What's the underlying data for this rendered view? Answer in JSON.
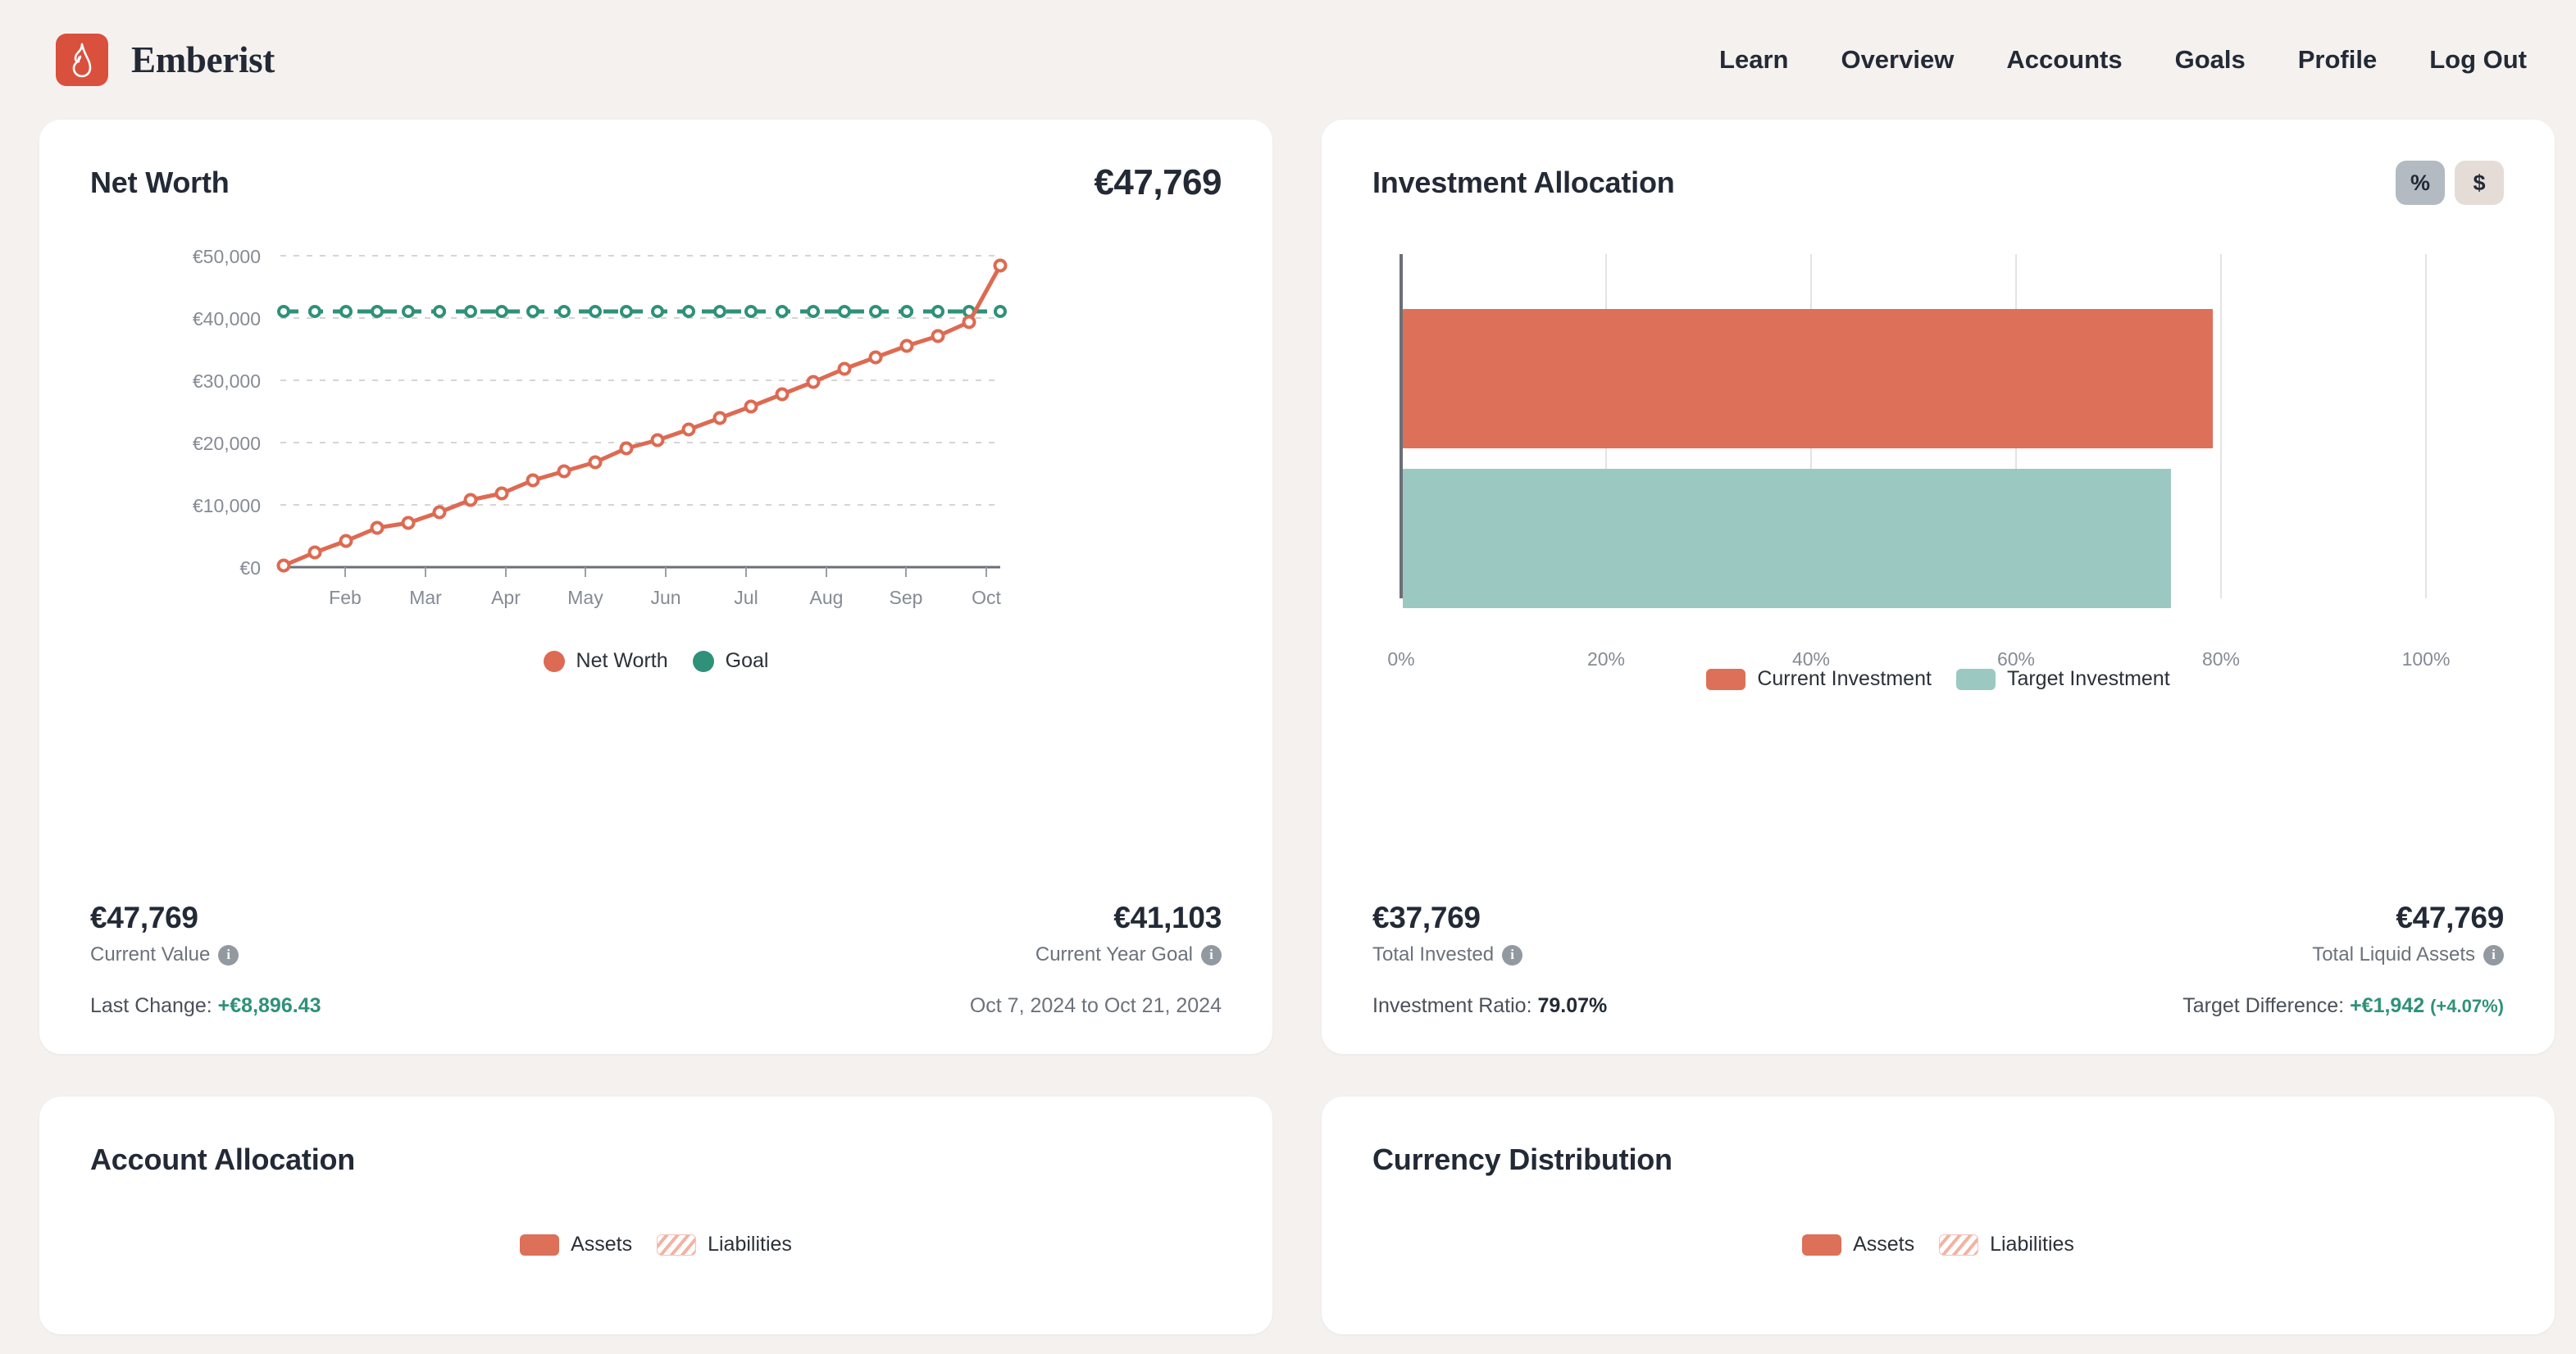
{
  "header": {
    "brand": "Emberist",
    "logo_icon": "flame-icon",
    "logo_color": "#d9503c",
    "nav": [
      {
        "label": "Learn"
      },
      {
        "label": "Overview"
      },
      {
        "label": "Accounts"
      },
      {
        "label": "Goals"
      },
      {
        "label": "Profile"
      },
      {
        "label": "Log Out"
      }
    ]
  },
  "colors": {
    "page_background": "#f5f1ef",
    "card_background": "#ffffff",
    "accent_red": "#dd7059",
    "accent_teal": "#9cc8c2",
    "goal_teal": "#2f9179",
    "text_dark": "#232a36",
    "text_muted": "#6c727b",
    "positive_green": "#2f9179"
  },
  "net_worth_card": {
    "title": "Net Worth",
    "amount": "€47,769",
    "stats": {
      "left_value": "€47,769",
      "left_label": "Current Value",
      "left_info_icon": "info-icon",
      "right_value": "€41,103",
      "right_label": "Current Year Goal",
      "right_info_icon": "info-icon"
    },
    "meta": {
      "change_key": "Last Change:",
      "change_value": "+€8,896.43",
      "date_range": "Oct 7, 2024 to Oct 21, 2024"
    }
  },
  "investment_card": {
    "title": "Investment Allocation",
    "toggles": [
      {
        "label": "%",
        "state": "active"
      },
      {
        "label": "$",
        "state": "inactive"
      }
    ],
    "stats": {
      "left_value": "€37,769",
      "left_label": "Total Invested",
      "left_info_icon": "info-icon",
      "right_value": "€47,769",
      "right_label": "Total Liquid Assets",
      "right_info_icon": "info-icon"
    },
    "meta": {
      "ratio_key": "Investment Ratio:",
      "ratio_value": "79.07%",
      "difference_key": "Target Difference:",
      "difference_value": "+€1,942",
      "difference_pct": "(+4.07%)"
    }
  },
  "account_allocation_card": {
    "title": "Account Allocation",
    "legend": [
      {
        "label": "Assets",
        "style": "solid"
      },
      {
        "label": "Liabilities",
        "style": "hatched"
      }
    ]
  },
  "currency_distribution_card": {
    "title": "Currency Distribution",
    "legend": [
      {
        "label": "Assets",
        "style": "solid"
      },
      {
        "label": "Liabilities",
        "style": "hatched"
      }
    ]
  },
  "chart_data": [
    {
      "id": "net-worth-line",
      "type": "line",
      "title": "Net Worth",
      "xlabel": "",
      "ylabel": "",
      "ylim": [
        0,
        52000
      ],
      "yticks": [
        0,
        10000,
        20000,
        30000,
        40000,
        50000
      ],
      "ytick_labels": [
        "€0",
        "€10,000",
        "€20,000",
        "€30,000",
        "€40,000",
        "€50,000"
      ],
      "xtick_labels": [
        "Feb",
        "Mar",
        "Apr",
        "May",
        "Jun",
        "Jul",
        "Aug",
        "Sep",
        "Oct"
      ],
      "grid": true,
      "legend_position": "bottom",
      "series": [
        {
          "name": "Net Worth",
          "color": "#dd6a52",
          "style": "solid",
          "marker": "circle",
          "values": [
            300,
            2100,
            3900,
            6000,
            6700,
            8400,
            10300,
            11400,
            13500,
            14900,
            16400,
            18600,
            19900,
            21600,
            23400,
            25200,
            27200,
            29200,
            31300,
            33100,
            35000,
            36600,
            38900,
            47769
          ]
        },
        {
          "name": "Goal",
          "color": "#2f9179",
          "style": "dashed",
          "marker": "circle-open",
          "values": [
            41103,
            41103,
            41103,
            41103,
            41103,
            41103,
            41103,
            41103,
            41103,
            41103,
            41103,
            41103,
            41103,
            41103,
            41103,
            41103,
            41103,
            41103,
            41103,
            41103,
            41103,
            41103,
            41103,
            41103
          ]
        }
      ]
    },
    {
      "id": "investment-allocation-bar",
      "type": "bar",
      "orientation": "horizontal",
      "title": "Investment Allocation",
      "categories": [
        "Current Investment",
        "Target Investment"
      ],
      "values": [
        79.07,
        75.0
      ],
      "colors": [
        "#dd7059",
        "#9cc8c2"
      ],
      "xlabel": "",
      "ylabel": "",
      "xlim": [
        0,
        100
      ],
      "xticks": [
        0,
        20,
        40,
        60,
        80,
        100
      ],
      "xtick_labels": [
        "0%",
        "20%",
        "40%",
        "60%",
        "80%",
        "100%"
      ],
      "grid": true,
      "legend_position": "bottom"
    }
  ]
}
